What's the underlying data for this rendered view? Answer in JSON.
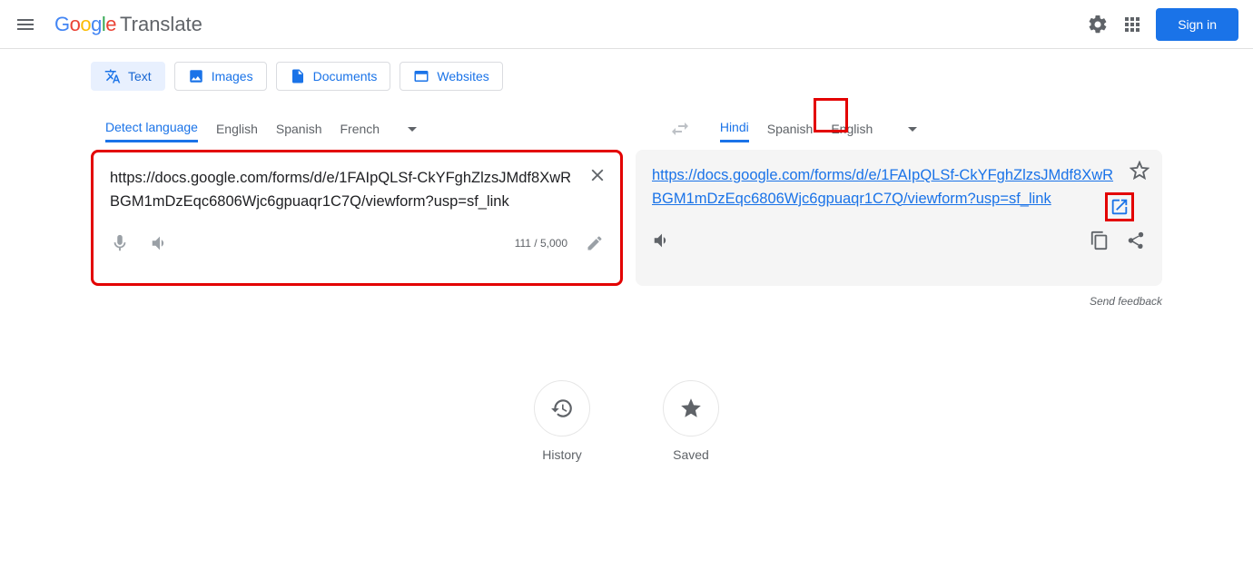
{
  "app": {
    "name": "Translate",
    "signin": "Sign in"
  },
  "modes": {
    "text": "Text",
    "images": "Images",
    "documents": "Documents",
    "websites": "Websites"
  },
  "source": {
    "langs": {
      "detect": "Detect language",
      "en": "English",
      "es": "Spanish",
      "fr": "French"
    },
    "text": "https://docs.google.com/forms/d/e/1FAIpQLSf-CkYFghZlzsJMdf8XwRBGM1mDzEqc6806Wjc6gpuaqr1C7Q/viewform?usp=sf_link",
    "count": "111 / 5,000"
  },
  "target": {
    "langs": {
      "hi": "Hindi",
      "es": "Spanish",
      "en": "English"
    },
    "text": "https://docs.google.com/forms/d/e/1FAIpQLSf-CkYFghZlzsJMdf8XwRBGM1mDzEqc6806Wjc6gpuaqr1C7Q/viewform?usp=sf_link"
  },
  "footer": {
    "feedback": "Send feedback",
    "history": "History",
    "saved": "Saved"
  }
}
